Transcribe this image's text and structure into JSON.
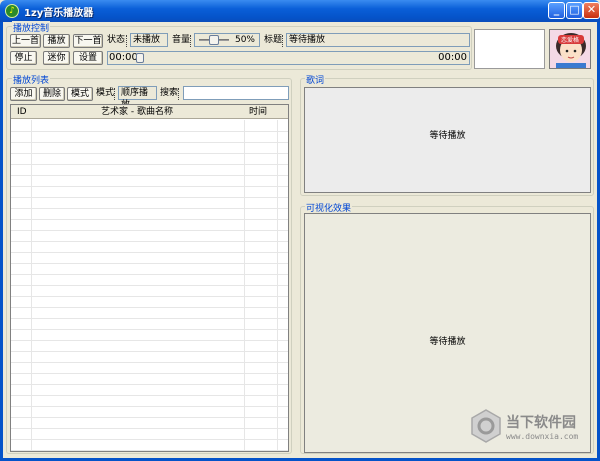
{
  "window": {
    "title": "1zy音乐播放器",
    "icon_glyph": "♪"
  },
  "window_buttons": {
    "minimize": "_",
    "maximize": "□",
    "close": "✕"
  },
  "controls": {
    "group_title": "播放控制",
    "prev": "上一首",
    "play": "播放",
    "next": "下一首",
    "stop": "停止",
    "mini": "迷你",
    "settings": "设置",
    "status_label": "状态",
    "status_value": "未播放",
    "volume_label": "音量",
    "volume_percent": "50%",
    "volume_level": 0.5,
    "title_label": "标题",
    "title_value": "等待播放",
    "time_current": "00:00",
    "time_total": "00:00",
    "progress": 0
  },
  "avatar": {
    "text": "恋爱格"
  },
  "playlist": {
    "group_title": "播放列表",
    "add": "添加",
    "delete": "删除",
    "mode_button": "模式",
    "mode_label": "模式",
    "mode_value": "顺序播放",
    "search_label": "搜索",
    "search_value": "",
    "columns": [
      "ID",
      "艺术家 - 歌曲名称",
      "时间"
    ]
  },
  "lyrics": {
    "group_title": "歌词",
    "placeholder": "等待播放"
  },
  "visualizer": {
    "group_title": "可视化效果",
    "placeholder": "等待播放"
  },
  "watermark": {
    "text": "当下软件园",
    "url": "www.downxia.com"
  },
  "colors": {
    "title_bar": "#0553c9",
    "group_label": "#0046d5",
    "face": "#ece9d8"
  }
}
